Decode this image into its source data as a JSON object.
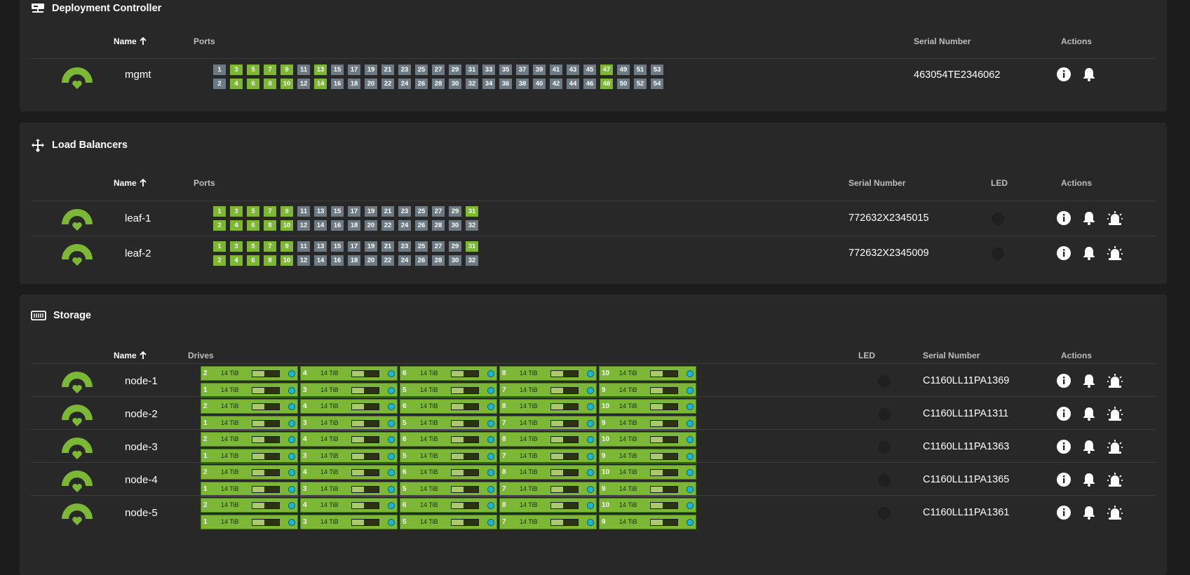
{
  "deployment": {
    "title": "Deployment Controller",
    "headers": {
      "name": "Name",
      "ports": "Ports",
      "serial": "Serial Number",
      "actions": "Actions"
    },
    "rows": [
      {
        "name": "mgmt",
        "serial": "463054TE2346062",
        "ports_odd": [
          {
            "n": "1",
            "up": false
          },
          {
            "n": "3",
            "up": true
          },
          {
            "n": "5",
            "up": true
          },
          {
            "n": "7",
            "up": true
          },
          {
            "n": "9",
            "up": true
          },
          {
            "n": "11",
            "up": false
          },
          {
            "n": "13",
            "up": true
          },
          {
            "n": "15",
            "up": false
          },
          {
            "n": "17",
            "up": false
          },
          {
            "n": "19",
            "up": false
          },
          {
            "n": "21",
            "up": false
          },
          {
            "n": "23",
            "up": false
          },
          {
            "n": "25",
            "up": false
          },
          {
            "n": "27",
            "up": false
          },
          {
            "n": "29",
            "up": false
          },
          {
            "n": "31",
            "up": false
          },
          {
            "n": "33",
            "up": false
          },
          {
            "n": "35",
            "up": false
          },
          {
            "n": "37",
            "up": false
          },
          {
            "n": "39",
            "up": false
          },
          {
            "n": "41",
            "up": false
          },
          {
            "n": "43",
            "up": false
          },
          {
            "n": "45",
            "up": false
          },
          {
            "n": "47",
            "up": true
          },
          {
            "n": "49",
            "up": false
          },
          {
            "n": "51",
            "up": false
          },
          {
            "n": "53",
            "up": false
          }
        ],
        "ports_even": [
          {
            "n": "2",
            "up": false
          },
          {
            "n": "4",
            "up": true
          },
          {
            "n": "6",
            "up": true
          },
          {
            "n": "8",
            "up": true
          },
          {
            "n": "10",
            "up": true
          },
          {
            "n": "12",
            "up": false
          },
          {
            "n": "14",
            "up": true
          },
          {
            "n": "16",
            "up": false
          },
          {
            "n": "18",
            "up": false
          },
          {
            "n": "20",
            "up": false
          },
          {
            "n": "22",
            "up": false
          },
          {
            "n": "24",
            "up": false
          },
          {
            "n": "26",
            "up": false
          },
          {
            "n": "28",
            "up": false
          },
          {
            "n": "30",
            "up": false
          },
          {
            "n": "32",
            "up": false
          },
          {
            "n": "34",
            "up": false
          },
          {
            "n": "36",
            "up": false
          },
          {
            "n": "38",
            "up": false
          },
          {
            "n": "40",
            "up": false
          },
          {
            "n": "42",
            "up": false
          },
          {
            "n": "44",
            "up": false
          },
          {
            "n": "46",
            "up": false
          },
          {
            "n": "48",
            "up": true
          },
          {
            "n": "50",
            "up": false
          },
          {
            "n": "52",
            "up": false
          },
          {
            "n": "54",
            "up": false
          }
        ]
      }
    ]
  },
  "load_balancers": {
    "title": "Load Balancers",
    "headers": {
      "name": "Name",
      "ports": "Ports",
      "serial": "Serial Number",
      "led": "LED",
      "actions": "Actions"
    },
    "rows": [
      {
        "name": "leaf-1",
        "serial": "772632X2345015",
        "ports_odd": [
          {
            "n": "1",
            "up": true
          },
          {
            "n": "3",
            "up": true
          },
          {
            "n": "5",
            "up": true
          },
          {
            "n": "7",
            "up": true
          },
          {
            "n": "9",
            "up": true
          },
          {
            "n": "11",
            "up": false
          },
          {
            "n": "13",
            "up": false
          },
          {
            "n": "15",
            "up": false
          },
          {
            "n": "17",
            "up": false
          },
          {
            "n": "19",
            "up": false
          },
          {
            "n": "21",
            "up": false
          },
          {
            "n": "23",
            "up": false
          },
          {
            "n": "25",
            "up": false
          },
          {
            "n": "27",
            "up": false
          },
          {
            "n": "29",
            "up": false
          },
          {
            "n": "31",
            "up": true
          }
        ],
        "ports_even": [
          {
            "n": "2",
            "up": true
          },
          {
            "n": "4",
            "up": true
          },
          {
            "n": "6",
            "up": true
          },
          {
            "n": "8",
            "up": true
          },
          {
            "n": "10",
            "up": true
          },
          {
            "n": "12",
            "up": false
          },
          {
            "n": "14",
            "up": false
          },
          {
            "n": "16",
            "up": false
          },
          {
            "n": "18",
            "up": false
          },
          {
            "n": "20",
            "up": false
          },
          {
            "n": "22",
            "up": false
          },
          {
            "n": "24",
            "up": false
          },
          {
            "n": "26",
            "up": false
          },
          {
            "n": "28",
            "up": false
          },
          {
            "n": "30",
            "up": false
          },
          {
            "n": "32",
            "up": false
          }
        ]
      },
      {
        "name": "leaf-2",
        "serial": "772632X2345009",
        "ports_odd": [
          {
            "n": "1",
            "up": true
          },
          {
            "n": "3",
            "up": true
          },
          {
            "n": "5",
            "up": true
          },
          {
            "n": "7",
            "up": true
          },
          {
            "n": "9",
            "up": true
          },
          {
            "n": "11",
            "up": false
          },
          {
            "n": "13",
            "up": false
          },
          {
            "n": "15",
            "up": false
          },
          {
            "n": "17",
            "up": false
          },
          {
            "n": "19",
            "up": false
          },
          {
            "n": "21",
            "up": false
          },
          {
            "n": "23",
            "up": false
          },
          {
            "n": "25",
            "up": false
          },
          {
            "n": "27",
            "up": false
          },
          {
            "n": "29",
            "up": false
          },
          {
            "n": "31",
            "up": true
          }
        ],
        "ports_even": [
          {
            "n": "2",
            "up": true
          },
          {
            "n": "4",
            "up": true
          },
          {
            "n": "6",
            "up": true
          },
          {
            "n": "8",
            "up": true
          },
          {
            "n": "10",
            "up": true
          },
          {
            "n": "12",
            "up": false
          },
          {
            "n": "14",
            "up": false
          },
          {
            "n": "16",
            "up": false
          },
          {
            "n": "18",
            "up": false
          },
          {
            "n": "20",
            "up": false
          },
          {
            "n": "22",
            "up": false
          },
          {
            "n": "24",
            "up": false
          },
          {
            "n": "26",
            "up": false
          },
          {
            "n": "28",
            "up": false
          },
          {
            "n": "30",
            "up": false
          },
          {
            "n": "32",
            "up": false
          }
        ]
      }
    ]
  },
  "storage": {
    "title": "Storage",
    "headers": {
      "name": "Name",
      "drives": "Drives",
      "led": "LED",
      "serial": "Serial Number",
      "actions": "Actions"
    },
    "drive_top": [
      "2",
      "4",
      "6",
      "8",
      "10"
    ],
    "drive_bottom": [
      "1",
      "3",
      "5",
      "7",
      "9"
    ],
    "drive_capacity": "14 TiB",
    "drive_usage": 0.45,
    "rows": [
      {
        "name": "node-1",
        "serial": "C1160LL11PA1369"
      },
      {
        "name": "node-2",
        "serial": "C1160LL11PA1311"
      },
      {
        "name": "node-3",
        "serial": "C1160LL11PA1363"
      },
      {
        "name": "node-4",
        "serial": "C1160LL11PA1365"
      },
      {
        "name": "node-5",
        "serial": "C1160LL11PA1361"
      }
    ]
  },
  "colors": {
    "port_up": "#7cb836",
    "port_down": "#6d7a84",
    "status_ok": "#7cb836"
  }
}
